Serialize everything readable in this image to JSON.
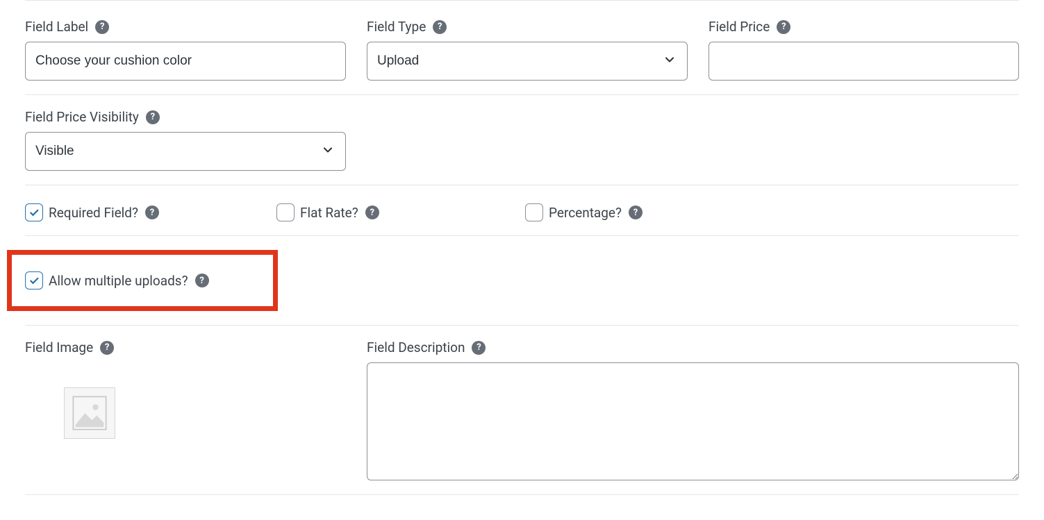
{
  "labels": {
    "field_label": "Field Label",
    "field_type": "Field Type",
    "field_price": "Field Price",
    "field_price_visibility": "Field Price Visibility",
    "required_field": "Required Field?",
    "flat_rate": "Flat Rate?",
    "percentage": "Percentage?",
    "allow_multiple_uploads": "Allow multiple uploads?",
    "field_image": "Field Image",
    "field_description": "Field Description"
  },
  "values": {
    "field_label": "Choose your cushion color",
    "field_type": "Upload",
    "field_price": "",
    "field_price_visibility": "Visible",
    "field_description": ""
  },
  "checks": {
    "required_field": true,
    "flat_rate": false,
    "percentage": false,
    "allow_multiple_uploads": true
  }
}
